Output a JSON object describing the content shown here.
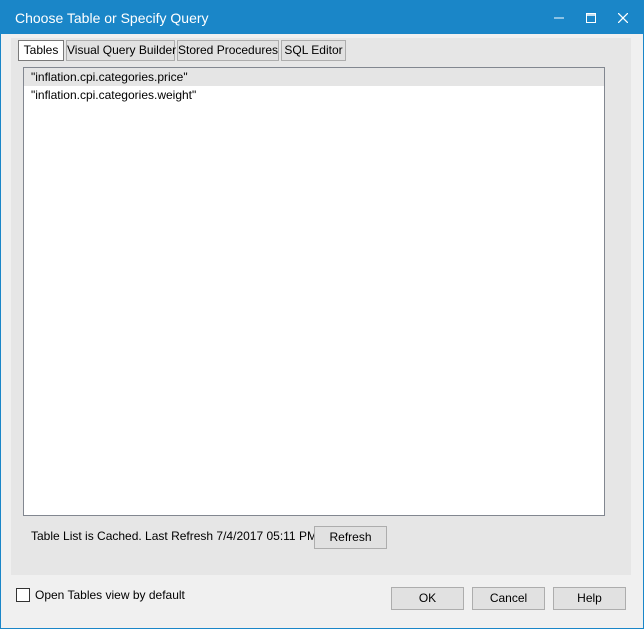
{
  "window": {
    "title": "Choose Table or Specify Query",
    "controls": {
      "minimize_icon": "minimize-icon",
      "maximize_icon": "maximize-icon",
      "close_icon": "close-icon"
    }
  },
  "tabs": [
    {
      "label": "Tables",
      "active": true
    },
    {
      "label": "Visual Query Builder",
      "active": false
    },
    {
      "label": "Stored Procedures",
      "active": false
    },
    {
      "label": "SQL Editor",
      "active": false
    }
  ],
  "table_list": {
    "items": [
      {
        "label": "\"inflation.cpi.categories.price\"",
        "selected": true
      },
      {
        "label": "\"inflation.cpi.categories.weight\"",
        "selected": false
      }
    ]
  },
  "status": {
    "text": "Table List is Cached.  Last Refresh 7/4/2017 05:11 PM",
    "refresh_label": "Refresh"
  },
  "options": {
    "open_tables_default_label": "Open Tables view by default",
    "open_tables_default_checked": false
  },
  "buttons": {
    "ok_label": "OK",
    "cancel_label": "Cancel",
    "help_label": "Help"
  },
  "colors": {
    "titlebar": "#1a86c8",
    "content_bg": "#e6e6e6",
    "window_bg": "#f0f0f0"
  }
}
